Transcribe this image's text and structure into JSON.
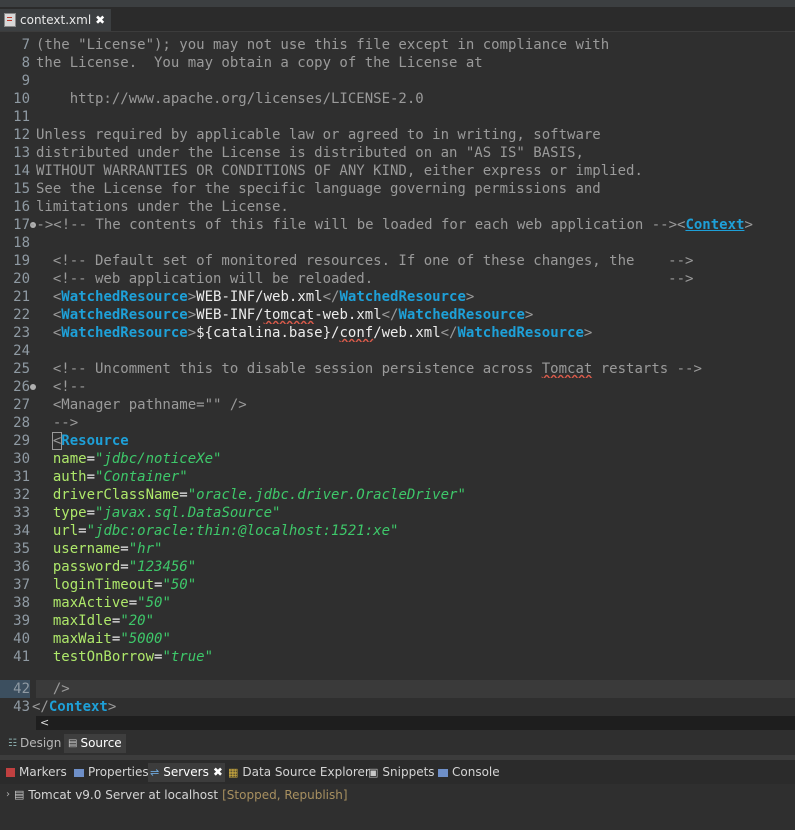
{
  "editor_tab": {
    "label": "context.xml",
    "close": "✖"
  },
  "line_numbers": [
    "7",
    "8",
    "9",
    "10",
    "11",
    "12",
    "13",
    "14",
    "15",
    "16",
    "17",
    "18",
    "19",
    "20",
    "21",
    "22",
    "23",
    "24",
    "25",
    "26",
    "27",
    "28",
    "29",
    "30",
    "31",
    "32",
    "33",
    "34",
    "35",
    "36",
    "37",
    "38",
    "39",
    "40",
    "41",
    "42",
    "43"
  ],
  "code": {
    "l7": "(the \"License\"); you may not use this file except in compliance with",
    "l8": "the License.  You may obtain a copy of the License at",
    "l10": "    http://www.apache.org/licenses/LICENSE-2.0",
    "l12": "Unless required by applicable law or agreed to in writing, software",
    "l13": "distributed under the License is distributed on an \"AS IS\" BASIS,",
    "l14": "WITHOUT WARRANTIES OR CONDITIONS OF ANY KIND, either express or implied.",
    "l15": "See the License for the specific language governing permissions and",
    "l16": "limitations under the License.",
    "l17_a": "--><!-- The contents of this file will be loaded for each web application --><",
    "l17_tag": "Context",
    "l17_b": ">",
    "l19": "  <!-- Default set of monitored resources. If one of these changes, the    -->",
    "l20": "  <!-- web application will be reloaded.                                   -->",
    "wr_tag": "WatchedResource",
    "l21_text": "WEB-INF/web.xml",
    "l22_t1": "WEB-INF/",
    "l22_t2": "tomcat",
    "l22_t3": "-web.xml",
    "l23_t1": "${catalina.base}/",
    "l23_t2": "conf",
    "l23_t3": "/web.xml",
    "l25_a": "  <!-- Uncomment this to disable session persistence across ",
    "l25_b": "Tomcat",
    "l25_c": " restarts -->",
    "l26": "  <!--",
    "l27": "  <Manager pathname=\"\" />",
    "l28": "  -->",
    "resource_tag": "Resource",
    "attrs": [
      {
        "name": "name",
        "value": "\"jdbc/noticeXe\""
      },
      {
        "name": "auth",
        "value": "\"Container\""
      },
      {
        "name": "driverClassName",
        "value": "\"oracle.jdbc.driver.OracleDriver\""
      },
      {
        "name": "type",
        "value": "\"javax.sql.DataSource\""
      },
      {
        "name": "url",
        "value": "\"jdbc:oracle:thin:@localhost:1521:xe\""
      },
      {
        "name": "username",
        "value": "\"hr\""
      },
      {
        "name": "password",
        "value": "\"123456\""
      },
      {
        "name": "loginTimeout",
        "value": "\"50\""
      },
      {
        "name": "maxActive",
        "value": "\"50\""
      },
      {
        "name": "maxIdle",
        "value": "\"20\""
      },
      {
        "name": "maxWait",
        "value": "\"5000\""
      },
      {
        "name": "testOnBorrow",
        "value": "\"true\""
      }
    ],
    "l42": "  />",
    "l43_tag": "Context"
  },
  "view_tabs": {
    "design": "Design",
    "source": "Source"
  },
  "panel_tabs": {
    "markers": "Markers",
    "properties": "Properties",
    "servers": "Servers",
    "servers_close": "✖",
    "data_source": "Data Source Explorer",
    "snippets": "Snippets",
    "console": "Console"
  },
  "server": {
    "name": "Tomcat v9.0 Server at localhost",
    "status": "[Stopped, Republish]"
  },
  "colors": {
    "tag": "#1ea0d8",
    "comment": "#9a9a9a",
    "attribute": "#aee86a",
    "value": "#3ec86a",
    "background": "#2f2f2f"
  }
}
